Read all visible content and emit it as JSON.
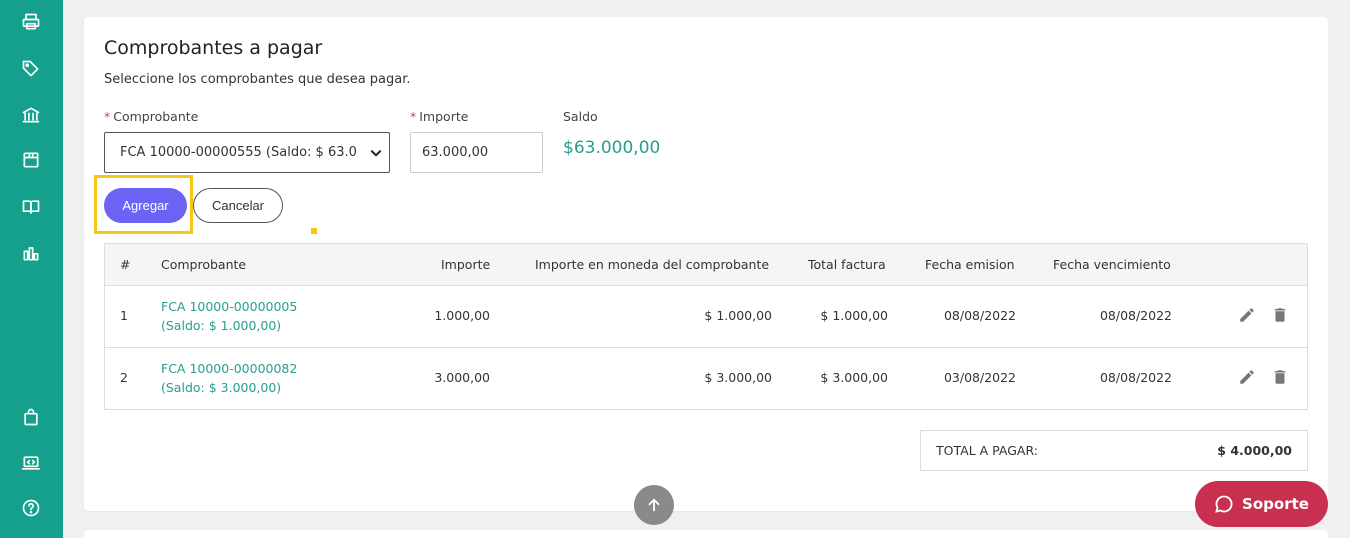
{
  "sidebar": {
    "icons": [
      "printer-icon",
      "tag-icon",
      "bank-icon",
      "box-icon",
      "book-icon",
      "bar-chart-icon",
      "shopping-bag-icon",
      "laptop-code-icon",
      "help-icon"
    ]
  },
  "page": {
    "title": "Comprobantes a pagar",
    "subtitle": "Seleccione los comprobantes que desea pagar."
  },
  "form": {
    "comprobante_label": "Comprobante",
    "comprobante_value": "FCA 10000-00000555 (Saldo: $ 63.0",
    "importe_label": "Importe",
    "importe_value": "63.000,00",
    "saldo_label": "Saldo",
    "saldo_value": "$63.000,00",
    "required_mark": "*",
    "add_label": "Agregar",
    "cancel_label": "Cancelar"
  },
  "table": {
    "headers": {
      "num": "#",
      "comprobante": "Comprobante",
      "importe": "Importe",
      "importe_moneda": "Importe en moneda del comprobante",
      "total_factura": "Total factura",
      "fecha_emision": "Fecha emision",
      "fecha_vencimiento": "Fecha vencimiento"
    },
    "rows": [
      {
        "num": "1",
        "comprobante": "FCA 10000-00000005",
        "saldo": "(Saldo: $ 1.000,00)",
        "importe": "1.000,00",
        "importe_moneda": "$ 1.000,00",
        "total_factura": "$ 1.000,00",
        "fecha_emision": "08/08/2022",
        "fecha_vencimiento": "08/08/2022"
      },
      {
        "num": "2",
        "comprobante": "FCA 10000-00000082",
        "saldo": "(Saldo: $ 3.000,00)",
        "importe": "3.000,00",
        "importe_moneda": "$ 3.000,00",
        "total_factura": "$ 3.000,00",
        "fecha_emision": "03/08/2022",
        "fecha_vencimiento": "08/08/2022"
      }
    ]
  },
  "totals": {
    "label": "TOTAL A PAGAR:",
    "value": "$ 4.000,00"
  },
  "support": {
    "label": "Soporte"
  },
  "colors": {
    "sidebar": "#14a08c",
    "accent_button": "#6c63f5",
    "link": "#2a9d8f",
    "support": "#c8304f",
    "highlight": "#f5c518"
  }
}
